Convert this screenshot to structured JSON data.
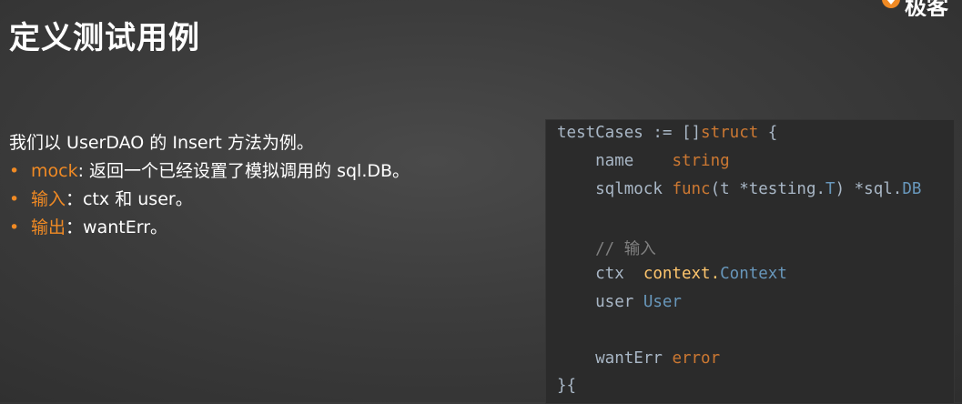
{
  "slide": {
    "title": "定义测试用例",
    "logo_text": "极客",
    "intro": "我们以 UserDAO 的 Insert 方法为例。",
    "bullets": [
      {
        "key": "mock",
        "sep": ": ",
        "text": "返回一个已经设置了模拟调用的 sql.DB。"
      },
      {
        "key": "输入",
        "sep": "：",
        "text": "ctx 和 user。"
      },
      {
        "key": "输出",
        "sep": "：",
        "text": "wantErr。"
      }
    ],
    "bullet_symbol": "•"
  },
  "code": {
    "l1_a": "testCases := []",
    "l1_kw": "struct",
    "l1_b": " {",
    "l2_name": "    name    ",
    "l2_type": "string",
    "l3_name": "    sqlmock",
    "l3_kw": " func",
    "l3_a": "(t ",
    "l3_b": "*testing.",
    "l3_c": "T",
    "l3_d": ") *sql.",
    "l3_e": "DB",
    "l5_comment": "    // 输入",
    "l6_name": "    ctx  ",
    "l6_pkg": "context.",
    "l6_type": "Context",
    "l7_name": "    user ",
    "l7_type": "User",
    "l9_name": "    wantErr ",
    "l9_type": "error",
    "l10": "}{"
  },
  "colors": {
    "accent": "#f08a24",
    "keyword": "#cc7832",
    "type": "#6897bb",
    "comment": "#808080",
    "code_bg": "#2b2b2b"
  }
}
